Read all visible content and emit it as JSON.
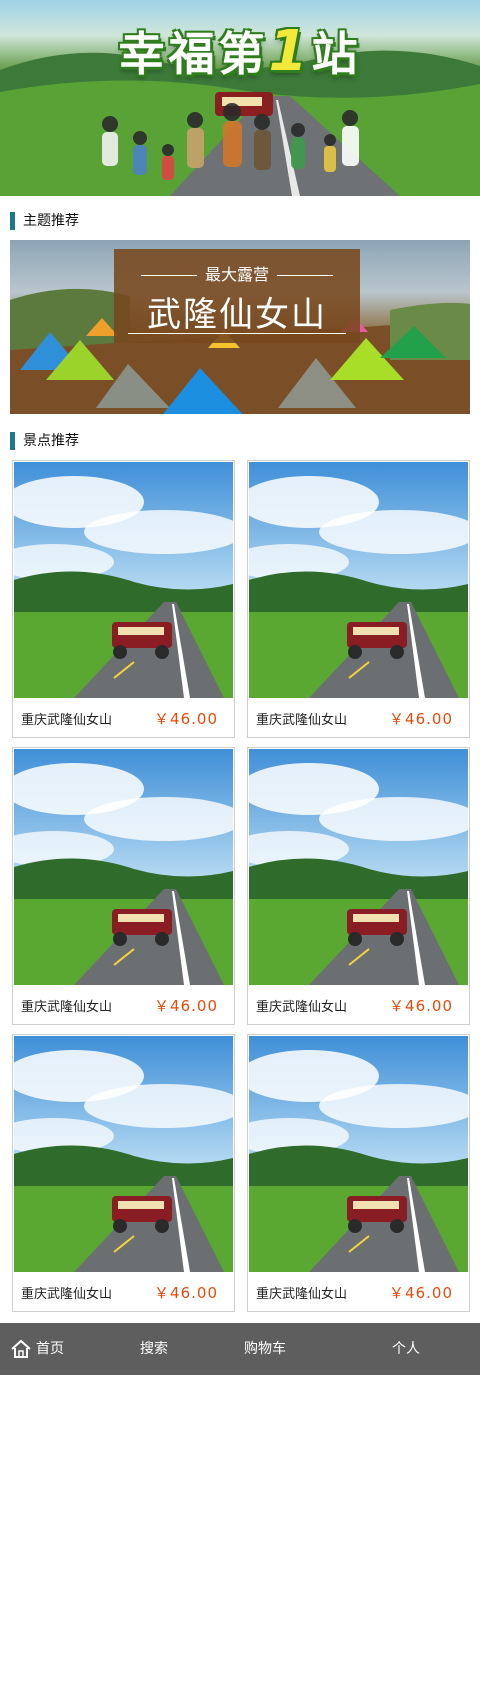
{
  "hero": {
    "title_part1": "幸福第",
    "title_num": "1",
    "title_part2": "站"
  },
  "sections": {
    "theme": "主题推荐",
    "spots": "景点推荐"
  },
  "theme_banner": {
    "subtitle": "最大露营",
    "title": "武隆仙女山"
  },
  "products": [
    {
      "name": "重庆武隆仙女山",
      "price": "￥46.00"
    },
    {
      "name": "重庆武隆仙女山",
      "price": "￥46.00"
    },
    {
      "name": "重庆武隆仙女山",
      "price": "￥46.00"
    },
    {
      "name": "重庆武隆仙女山",
      "price": "￥46.00"
    },
    {
      "name": "重庆武隆仙女山",
      "price": "￥46.00"
    },
    {
      "name": "重庆武隆仙女山",
      "price": "￥46.00"
    }
  ],
  "nav": {
    "home": "首页",
    "search": "搜索",
    "cart": "购物车",
    "profile": "个人",
    "home_icon": "house-icon"
  },
  "colors": {
    "accent_bar": "#1a7a8c",
    "price": "#e84a0c",
    "nav_bg": "#5e5e5e"
  }
}
